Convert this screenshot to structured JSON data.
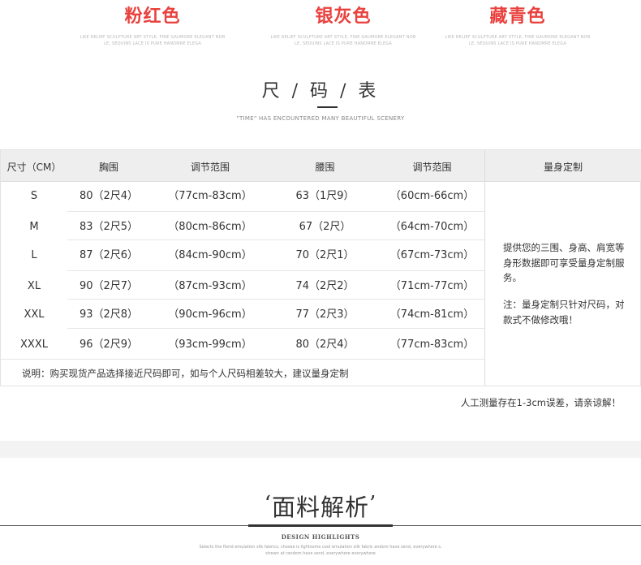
{
  "colors": [
    {
      "name": "粉红色",
      "line1": "LIKE RELIEF SCULPTURE ART STYLE, FINE GAUMORE ELEGANT NOB",
      "line2": "LE, SEQUINS LACE IS PURE HANDMRE ELEGA"
    },
    {
      "name": "银灰色",
      "line1": "LIKE RELIEF SCULPTURE ART STYLE, FINE GAUMORE ELEGANT NOB",
      "line2": "LE, SEQUINS LACE IS PURE HANDMRE ELEGA"
    },
    {
      "name": "藏青色",
      "line1": "LIKE RELIEF SCULPTURE ART STYLE, FINE GAUMORE ELEGANT NOB",
      "line2": "LE, SEQUINS LACE IS PURE HANDMRE ELEGA"
    }
  ],
  "accent_color": "#e8413e",
  "size_chart": {
    "title": "尺 / 码 / 表",
    "subtitle": "\"TIME\" HAS ENCOUNTERED MANY BEAUTIFUL SCENERY",
    "headers": [
      "尺寸（CM）",
      "胸围",
      "调节范围",
      "腰围",
      "调节范围"
    ],
    "rows": [
      [
        "S",
        "80（2尺4）",
        "（77cm-83cm）",
        "63（1尺9）",
        "（60cm-66cm）"
      ],
      [
        "M",
        "83（2尺5）",
        "（80cm-86cm）",
        "67（2尺）",
        "（64cm-70cm）"
      ],
      [
        "L",
        "87（2尺6）",
        "（84cm-90cm）",
        "70（2尺1）",
        "（67cm-73cm）"
      ],
      [
        "XL",
        "90（2尺7）",
        "（87cm-93cm）",
        "74（2尺2）",
        "（71cm-77cm）"
      ],
      [
        "XXL",
        "93（2尺8）",
        "（90cm-96cm）",
        "77（2尺3）",
        "（74cm-81cm）"
      ],
      [
        "XXXL",
        "96（2尺9）",
        "（93cm-99cm）",
        "80（2尺4）",
        "（77cm-83cm）"
      ]
    ],
    "note": "说明：购买现货产品选择接近尺码即可，如与个人尺码相差较大，建议量身定制",
    "custom_header": "量身定制",
    "custom_text": "提供您的三围、身高、肩宽等身形数据即可享受量身定制服务。",
    "custom_note": "注：量身定制只针对尺码，对款式不做修改哦！"
  },
  "error_note": "人工测量存在1-3cm误差，请亲谅解！",
  "fabric": {
    "title": "面料解析",
    "quote_open": "‘",
    "quote_close": "’",
    "heading": "DESIGN HIGHLIGHTS",
    "desc_line1": "Selects the florid emulation silk fabrics, choose is lightsome cool emulation silk fabric andom have send, everywhere s.",
    "desc_line2": "strewn at random have send, everywhere  everywhere"
  }
}
